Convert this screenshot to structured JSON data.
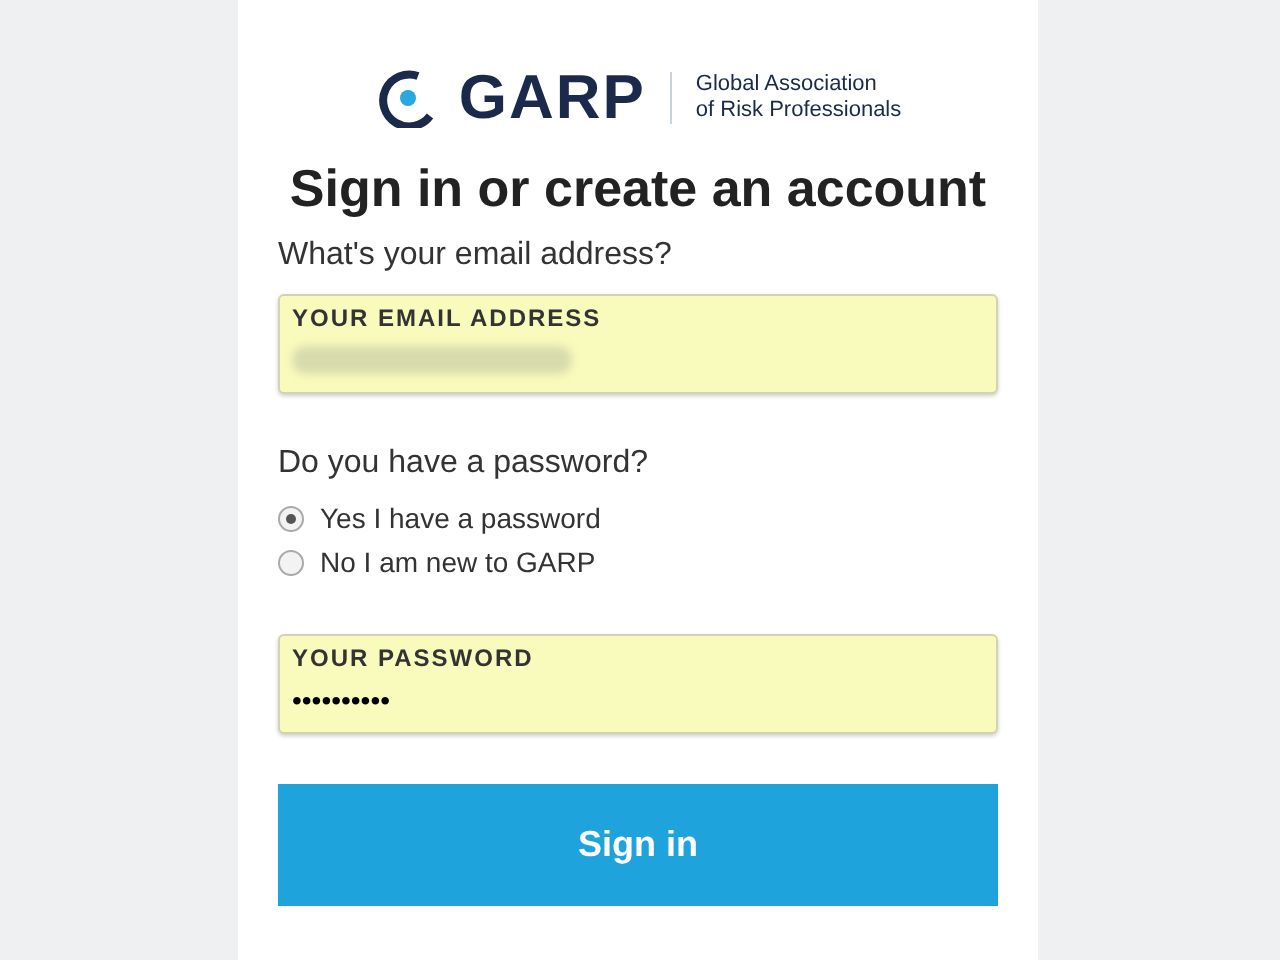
{
  "logo": {
    "mark": "GARP",
    "tagline": [
      "Global Association",
      "of Risk Professionals"
    ]
  },
  "heading": "Sign in or create an account",
  "email": {
    "question": "What's your email address?",
    "label": "YOUR EMAIL ADDRESS",
    "value_hidden": true
  },
  "password_question": "Do you have a password?",
  "options": [
    {
      "label": "Yes I have a password",
      "selected": true
    },
    {
      "label": "No I am new to GARP",
      "selected": false
    }
  ],
  "password": {
    "label": "YOUR PASSWORD",
    "value": "••••••••••"
  },
  "button": "Sign in"
}
